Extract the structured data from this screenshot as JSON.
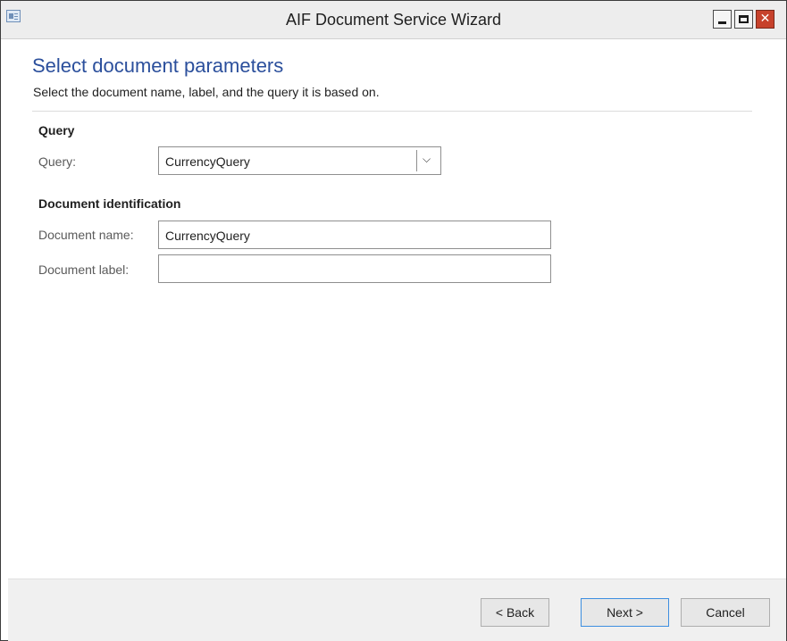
{
  "window": {
    "title": "AIF Document Service Wizard",
    "icons": {
      "app": "app-window-icon",
      "minimize": "minimize-icon",
      "maximize": "maximize-icon",
      "close": "close-icon"
    },
    "close_glyph": "✕",
    "colors": {
      "heading": "#2b4f9c",
      "close": "#c7422c",
      "focus": "#3d8ee0"
    }
  },
  "page": {
    "heading": "Select document parameters",
    "description": "Select the document name, label, and the query it is based on."
  },
  "query_group": {
    "title": "Query",
    "query_label": "Query:",
    "query_value": "CurrencyQuery",
    "dropdown_icon": "chevron-down-icon",
    "dropdown_glyph": "⌵"
  },
  "document_group": {
    "title": "Document identification",
    "name_label": "Document name:",
    "name_value": "CurrencyQuery",
    "label_label": "Document label:",
    "label_value": ""
  },
  "buttons": {
    "back": "< Back",
    "next": "Next >",
    "cancel": "Cancel"
  }
}
